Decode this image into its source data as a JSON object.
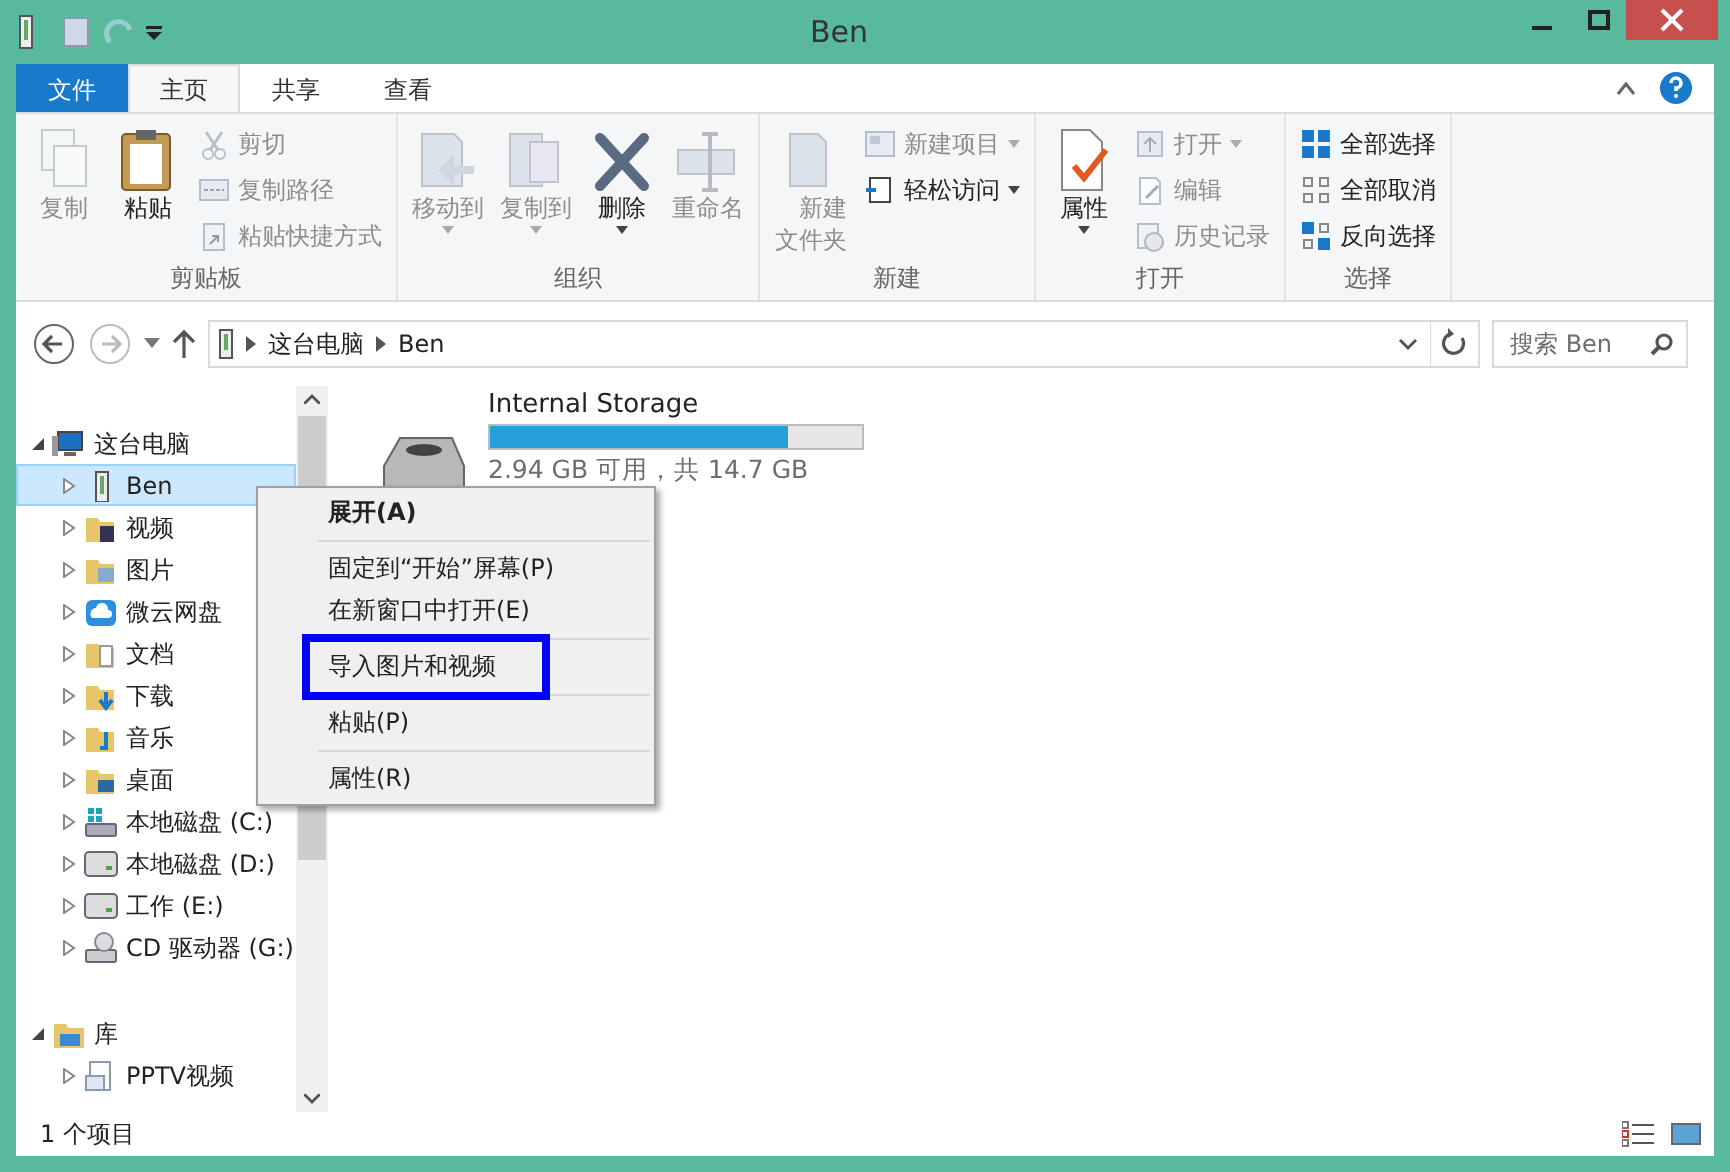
{
  "window": {
    "title": "Ben"
  },
  "ribbon_tabs": [
    {
      "label": "文件",
      "kind": "file",
      "selected": false
    },
    {
      "label": "主页",
      "kind": "tab",
      "selected": true
    },
    {
      "label": "共享",
      "kind": "tab",
      "selected": false
    },
    {
      "label": "查看",
      "kind": "tab",
      "selected": false
    }
  ],
  "ribbon": {
    "groups": [
      {
        "label": "剪贴板",
        "items": [
          {
            "kind": "big",
            "label": "复制",
            "disabled": true,
            "dropdown": false
          },
          {
            "kind": "big",
            "label": "粘贴",
            "disabled": false,
            "dropdown": false
          },
          {
            "kind": "small",
            "label": "剪切",
            "disabled": true,
            "dropdown": false
          },
          {
            "kind": "small",
            "label": "复制路径",
            "disabled": true,
            "dropdown": false
          },
          {
            "kind": "small",
            "label": "粘贴快捷方式",
            "disabled": true,
            "dropdown": false
          }
        ]
      },
      {
        "label": "组织",
        "items": [
          {
            "kind": "big",
            "label": "移动到",
            "disabled": true,
            "dropdown": true
          },
          {
            "kind": "big",
            "label": "复制到",
            "disabled": true,
            "dropdown": true
          },
          {
            "kind": "big",
            "label": "删除",
            "disabled": false,
            "dropdown": true
          },
          {
            "kind": "big",
            "label": "重命名",
            "disabled": true,
            "dropdown": false
          }
        ]
      },
      {
        "label": "新建",
        "items": [
          {
            "kind": "big",
            "label": "新建文件夹",
            "disabled": true,
            "dropdown": false
          },
          {
            "kind": "small",
            "label": "新建项目",
            "disabled": true,
            "dropdown": true
          },
          {
            "kind": "small",
            "label": "轻松访问",
            "disabled": false,
            "dropdown": true
          }
        ]
      },
      {
        "label": "打开",
        "items": [
          {
            "kind": "big",
            "label": "属性",
            "disabled": false,
            "dropdown": true
          },
          {
            "kind": "small",
            "label": "打开",
            "disabled": true,
            "dropdown": true
          },
          {
            "kind": "small",
            "label": "编辑",
            "disabled": true,
            "dropdown": false
          },
          {
            "kind": "small",
            "label": "历史记录",
            "disabled": true,
            "dropdown": false
          }
        ]
      },
      {
        "label": "选择",
        "items": [
          {
            "kind": "small",
            "label": "全部选择",
            "disabled": false,
            "dropdown": false
          },
          {
            "kind": "small",
            "label": "全部取消",
            "disabled": false,
            "dropdown": false
          },
          {
            "kind": "small",
            "label": "反向选择",
            "disabled": false,
            "dropdown": false
          }
        ]
      }
    ]
  },
  "address_bar": {
    "path": [
      "这台电脑",
      "Ben"
    ]
  },
  "search": {
    "placeholder": "搜索 Ben"
  },
  "navigation": [
    {
      "label": "这台电脑",
      "kind": "computer",
      "expanded": true,
      "selected": false,
      "children": [
        {
          "label": "Ben",
          "kind": "device",
          "expanded": false,
          "selected": true
        },
        {
          "label": "视频",
          "kind": "videos",
          "expanded": false,
          "selected": false
        },
        {
          "label": "图片",
          "kind": "pictures",
          "expanded": false,
          "selected": false
        },
        {
          "label": "微云网盘",
          "kind": "cloud",
          "expanded": false,
          "selected": false
        },
        {
          "label": "文档",
          "kind": "documents",
          "expanded": false,
          "selected": false
        },
        {
          "label": "下载",
          "kind": "downloads",
          "expanded": false,
          "selected": false
        },
        {
          "label": "音乐",
          "kind": "music",
          "expanded": false,
          "selected": false
        },
        {
          "label": "桌面",
          "kind": "desktop",
          "expanded": false,
          "selected": false
        },
        {
          "label": "本地磁盘 (C:)",
          "kind": "system-drive",
          "expanded": false,
          "selected": false
        },
        {
          "label": "本地磁盘 (D:)",
          "kind": "drive",
          "expanded": false,
          "selected": false
        },
        {
          "label": "工作 (E:)",
          "kind": "drive",
          "expanded": false,
          "selected": false
        },
        {
          "label": "CD 驱动器 (G:)",
          "kind": "cd",
          "expanded": false,
          "selected": false
        }
      ]
    },
    {
      "label": "库",
      "kind": "library",
      "expanded": true,
      "selected": false,
      "children": [
        {
          "label": "PPTV视频",
          "kind": "library-item",
          "expanded": false,
          "selected": false
        }
      ]
    }
  ],
  "content": {
    "items": [
      {
        "name": "Internal Storage",
        "level": 0.8,
        "reading": "2.94 GB 可用，共 14.7 GB"
      }
    ]
  },
  "context_menu": [
    {
      "kind": "item",
      "label": "展开(A)",
      "default": true,
      "highlighted": false
    },
    {
      "kind": "separator"
    },
    {
      "kind": "item",
      "label": "固定到“开始”屏幕(P)",
      "default": false,
      "highlighted": false
    },
    {
      "kind": "item",
      "label": "在新窗口中打开(E)",
      "default": false,
      "highlighted": false
    },
    {
      "kind": "separator"
    },
    {
      "kind": "item",
      "label": "导入图片和视频",
      "default": false,
      "highlighted": true
    },
    {
      "kind": "separator"
    },
    {
      "kind": "item",
      "label": "粘贴(P)",
      "default": false,
      "highlighted": false
    },
    {
      "kind": "separator"
    },
    {
      "kind": "item",
      "label": "属性(R)",
      "default": false,
      "highlighted": false
    }
  ],
  "status_bar": {
    "text": "1 个项目"
  }
}
